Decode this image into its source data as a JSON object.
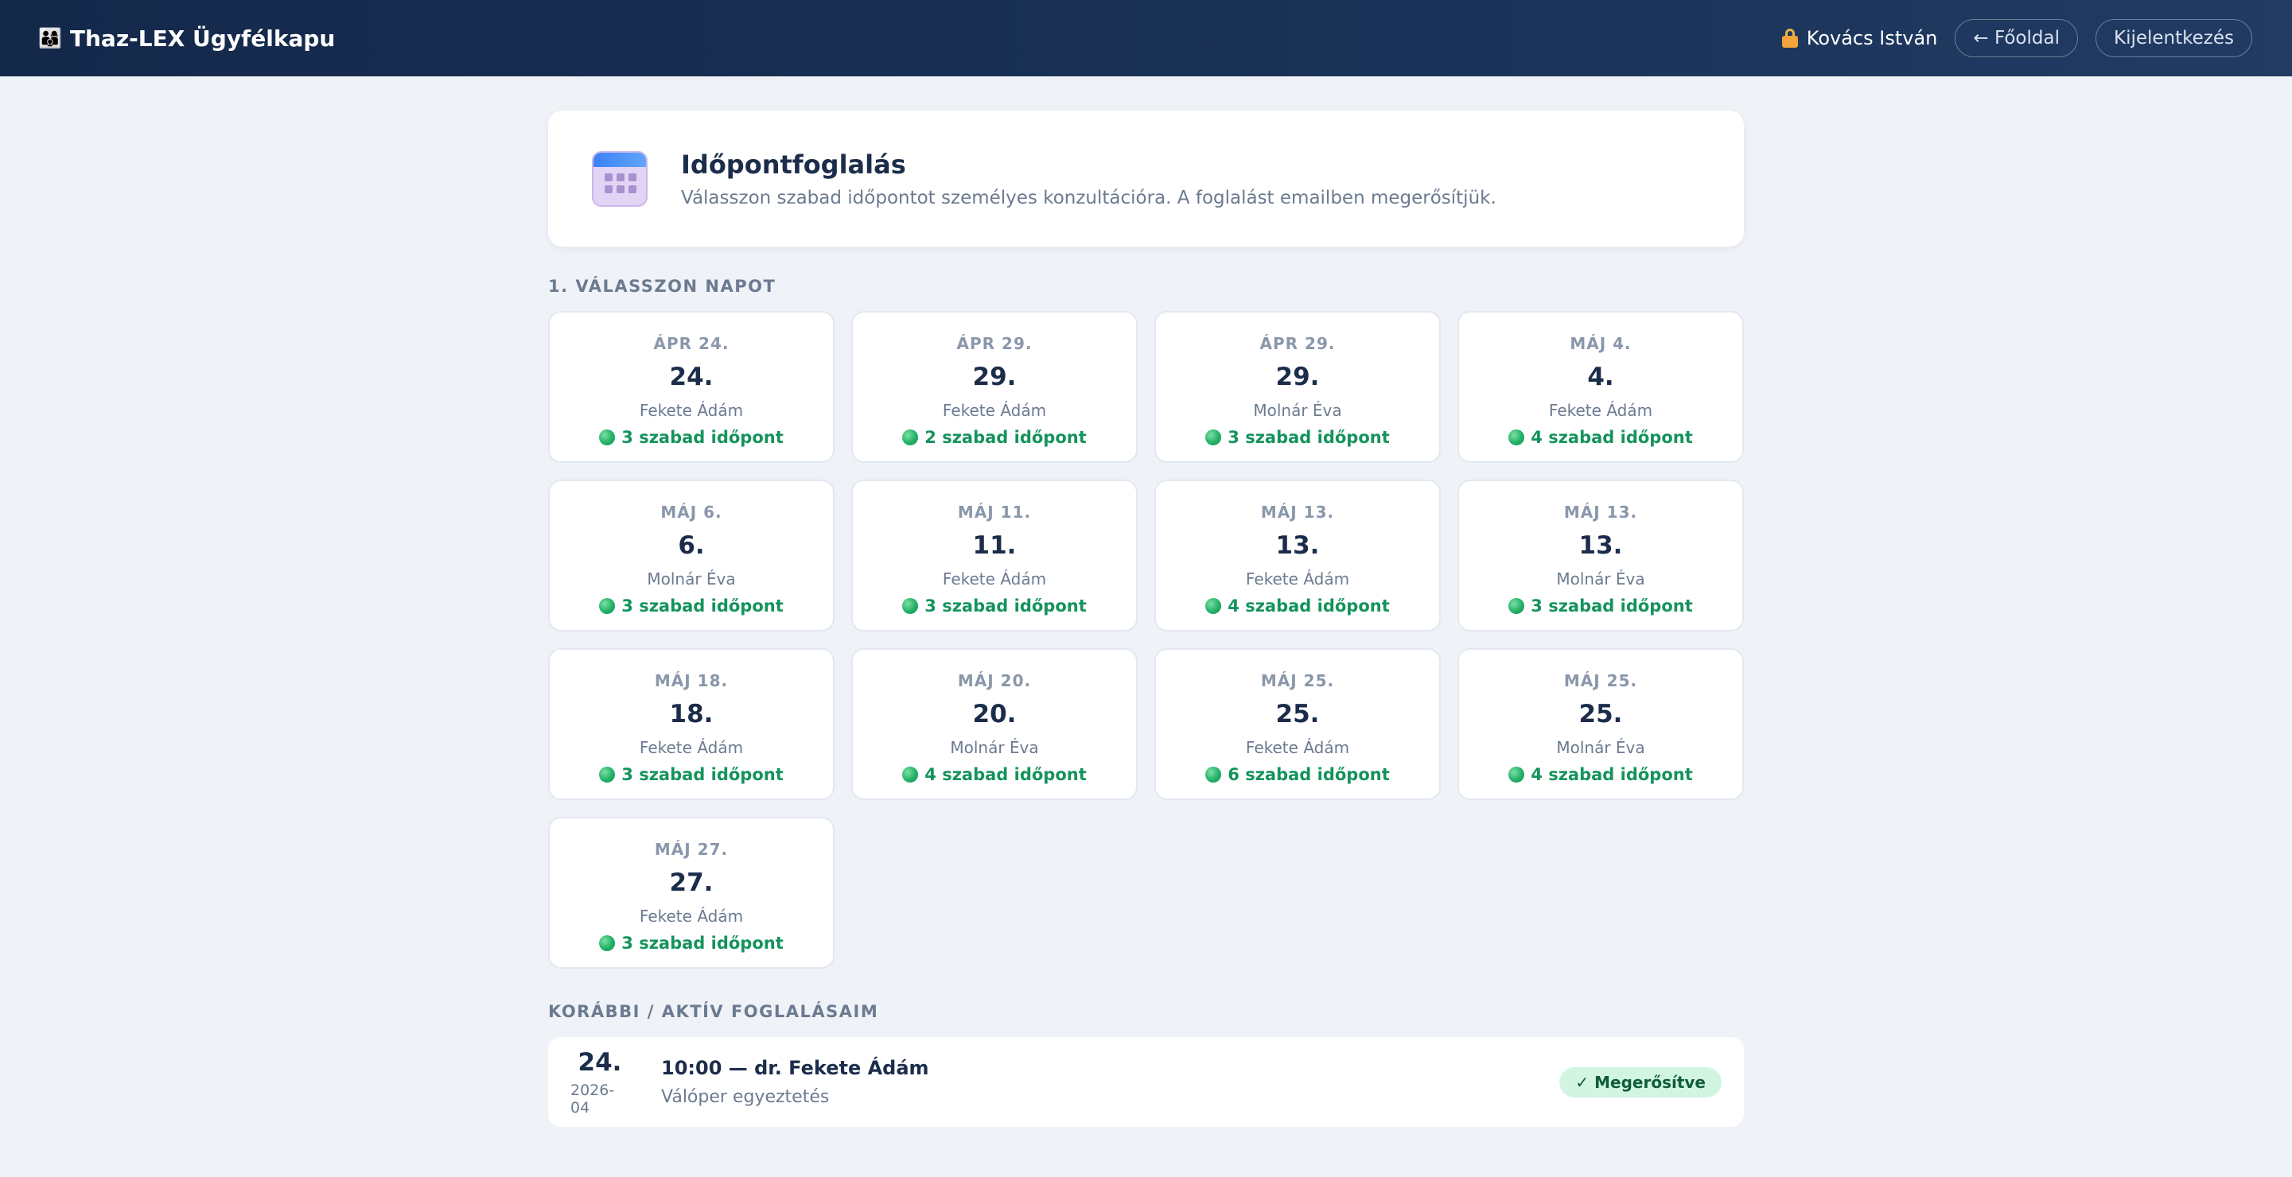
{
  "app": {
    "brand_icon": "👨‍👩‍👦",
    "brand": "Thaz-LEX Ügyfélkapu",
    "user_name": "Kovács István",
    "home_label": "← Főoldal",
    "logout_label": "Kijelentkezés"
  },
  "header": {
    "title": "Időpontfoglalás",
    "subtitle": "Válasszon szabad időpontot személyes konzultációra. A foglalást emailben megerősítjük."
  },
  "section_days": {
    "label": "1. VÁLASSZON NAPOT"
  },
  "days": [
    {
      "month": "ÁPR 24.",
      "num": "24.",
      "lawyer": "Fekete Ádám",
      "slots": "3 szabad időpont"
    },
    {
      "month": "ÁPR 29.",
      "num": "29.",
      "lawyer": "Fekete Ádám",
      "slots": "2 szabad időpont"
    },
    {
      "month": "ÁPR 29.",
      "num": "29.",
      "lawyer": "Molnár Éva",
      "slots": "3 szabad időpont"
    },
    {
      "month": "MÁJ 4.",
      "num": "4.",
      "lawyer": "Fekete Ádám",
      "slots": "4 szabad időpont"
    },
    {
      "month": "MÁJ 6.",
      "num": "6.",
      "lawyer": "Molnár Éva",
      "slots": "3 szabad időpont"
    },
    {
      "month": "MÁJ 11.",
      "num": "11.",
      "lawyer": "Fekete Ádám",
      "slots": "3 szabad időpont"
    },
    {
      "month": "MÁJ 13.",
      "num": "13.",
      "lawyer": "Fekete Ádám",
      "slots": "4 szabad időpont"
    },
    {
      "month": "MÁJ 13.",
      "num": "13.",
      "lawyer": "Molnár Éva",
      "slots": "3 szabad időpont"
    },
    {
      "month": "MÁJ 18.",
      "num": "18.",
      "lawyer": "Fekete Ádám",
      "slots": "3 szabad időpont"
    },
    {
      "month": "MÁJ 20.",
      "num": "20.",
      "lawyer": "Molnár Éva",
      "slots": "4 szabad időpont"
    },
    {
      "month": "MÁJ 25.",
      "num": "25.",
      "lawyer": "Fekete Ádám",
      "slots": "6 szabad időpont"
    },
    {
      "month": "MÁJ 25.",
      "num": "25.",
      "lawyer": "Molnár Éva",
      "slots": "4 szabad időpont"
    },
    {
      "month": "MÁJ 27.",
      "num": "27.",
      "lawyer": "Fekete Ádám",
      "slots": "3 szabad időpont"
    }
  ],
  "section_bookings": {
    "label": "KORÁBBI / AKTÍV FOGLALÁSAIM"
  },
  "bookings": [
    {
      "day": "24.",
      "year_month": "2026-04",
      "title": "10:00 — dr. Fekete Ádám",
      "subject": "Válóper egyeztetés",
      "status": "✓ Megerősítve"
    }
  ],
  "colors": {
    "accent_green": "#15935c",
    "nav_bg": "#14284a",
    "badge_bg": "#d2f5e3"
  },
  "icons": {
    "brand": "family-icon",
    "user": "lock-icon",
    "header": "calendar-icon",
    "slot": "green-dot-icon"
  }
}
